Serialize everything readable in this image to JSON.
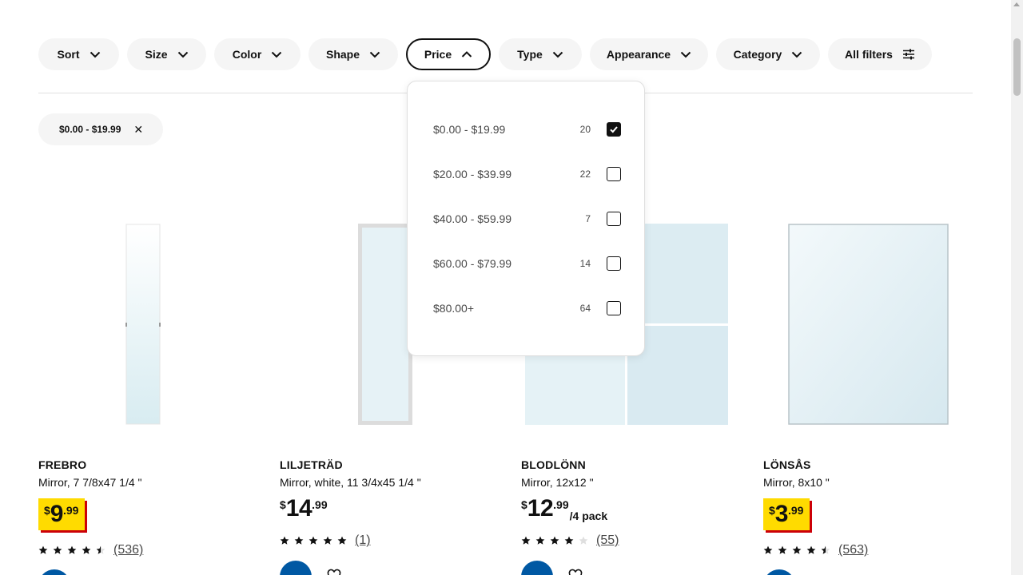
{
  "filters": [
    {
      "label": "Sort",
      "active": false
    },
    {
      "label": "Size",
      "active": false
    },
    {
      "label": "Color",
      "active": false
    },
    {
      "label": "Shape",
      "active": false
    },
    {
      "label": "Price",
      "active": true
    },
    {
      "label": "Type",
      "active": false
    },
    {
      "label": "Appearance",
      "active": false
    },
    {
      "label": "Category",
      "active": false
    },
    {
      "label": "All filters",
      "active": false
    }
  ],
  "applied_filter": {
    "label": "$0.00 - $19.99",
    "icon": "close-icon"
  },
  "price_dropdown": {
    "options": [
      {
        "label": "$0.00 - $19.99",
        "count": "20",
        "checked": true
      },
      {
        "label": "$20.00 - $39.99",
        "count": "22",
        "checked": false
      },
      {
        "label": "$40.00 - $59.99",
        "count": "7",
        "checked": false
      },
      {
        "label": "$60.00 - $79.99",
        "count": "14",
        "checked": false
      },
      {
        "label": "$80.00+",
        "count": "64",
        "checked": false
      }
    ]
  },
  "products": [
    {
      "name": "FREBRO",
      "desc": "Mirror, 7 7/8x47 1/4 \"",
      "currency": "$",
      "price_int": "9",
      "price_dec": ".99",
      "unit": "",
      "sale": true,
      "rating": 4.5,
      "reviews": "(536)"
    },
    {
      "name": "LILJETRÄD",
      "desc": "Mirror, white, 11 3/4x45 1/4 \"",
      "currency": "$",
      "price_int": "14",
      "price_dec": ".99",
      "unit": "",
      "sale": false,
      "rating": 5,
      "reviews": "(1)"
    },
    {
      "name": "BLODLÖNN",
      "desc": "Mirror, 12x12 \"",
      "currency": "$",
      "price_int": "12",
      "price_dec": ".99",
      "unit": "/4 pack",
      "sale": false,
      "rating": 4,
      "reviews": "(55)"
    },
    {
      "name": "LÖNSÅS",
      "desc": "Mirror, 8x10 \"",
      "currency": "$",
      "price_int": "3",
      "price_dec": ".99",
      "unit": "",
      "sale": true,
      "rating": 4.5,
      "reviews": "(563)"
    }
  ],
  "colors": {
    "sale_yellow": "#ffdb00",
    "sale_red": "#cc0008",
    "cart_blue": "#0058a3",
    "chip_bg": "#f5f5f5"
  }
}
